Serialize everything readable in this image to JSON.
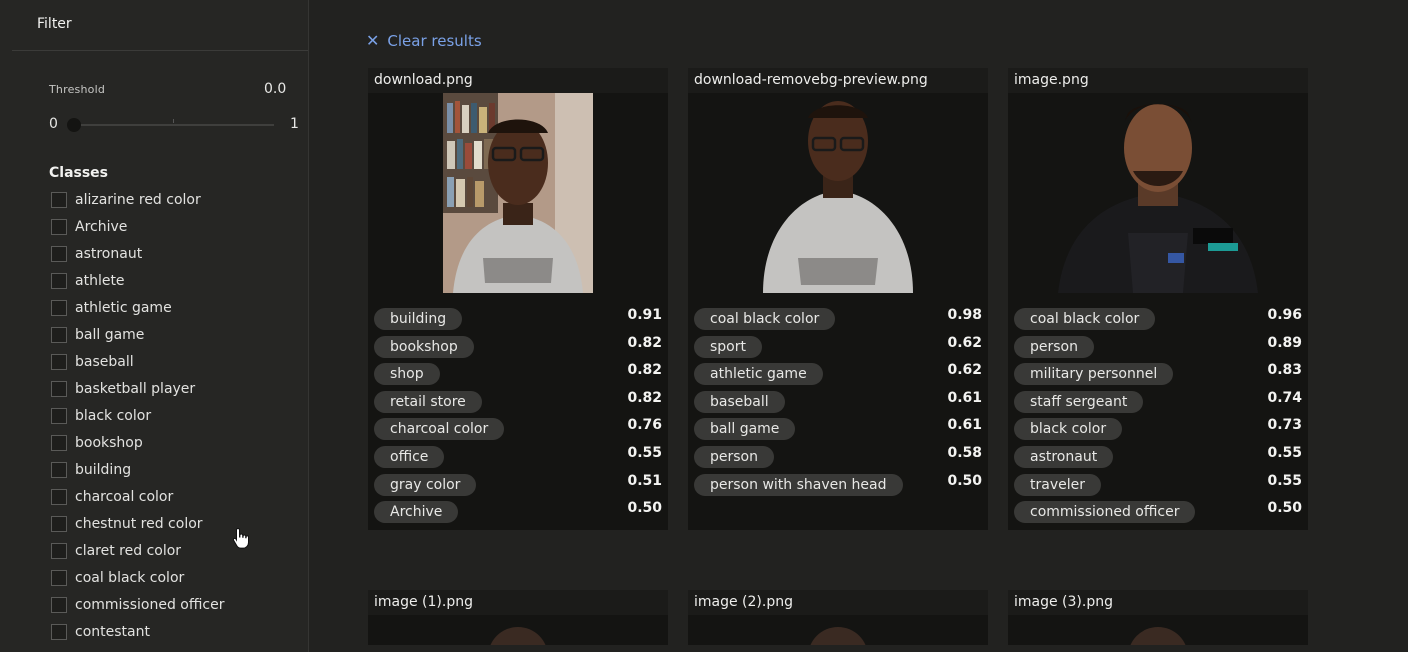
{
  "sidebar": {
    "filter_title": "Filter",
    "threshold_label": "Threshold",
    "threshold_value": "0.0",
    "slider_min": "0",
    "slider_max": "1",
    "classes_title": "Classes",
    "classes": [
      "alizarine red color",
      "Archive",
      "astronaut",
      "athlete",
      "athletic game",
      "ball game",
      "baseball",
      "basketball player",
      "black color",
      "bookshop",
      "building",
      "charcoal color",
      "chestnut red color",
      "claret red color",
      "coal black color",
      "commissioned officer",
      "contestant"
    ]
  },
  "main": {
    "clear_results": "Clear results",
    "cards": [
      {
        "filename": "download.png",
        "labels": [
          {
            "tag": "building",
            "score": "0.91"
          },
          {
            "tag": "bookshop",
            "score": "0.82"
          },
          {
            "tag": "shop",
            "score": "0.82"
          },
          {
            "tag": "retail store",
            "score": "0.82"
          },
          {
            "tag": "charcoal color",
            "score": "0.76"
          },
          {
            "tag": "office",
            "score": "0.55"
          },
          {
            "tag": "gray color",
            "score": "0.51"
          },
          {
            "tag": "Archive",
            "score": "0.50"
          }
        ]
      },
      {
        "filename": "download-removebg-preview.png",
        "labels": [
          {
            "tag": "coal black color",
            "score": "0.98"
          },
          {
            "tag": "sport",
            "score": "0.62"
          },
          {
            "tag": "athletic game",
            "score": "0.62"
          },
          {
            "tag": "baseball",
            "score": "0.61"
          },
          {
            "tag": "ball game",
            "score": "0.61"
          },
          {
            "tag": "person",
            "score": "0.58"
          },
          {
            "tag": "person with shaven head",
            "score": "0.50"
          }
        ]
      },
      {
        "filename": "image.png",
        "labels": [
          {
            "tag": "coal black color",
            "score": "0.96"
          },
          {
            "tag": "person",
            "score": "0.89"
          },
          {
            "tag": "military personnel",
            "score": "0.83"
          },
          {
            "tag": "staff sergeant",
            "score": "0.74"
          },
          {
            "tag": "black color",
            "score": "0.73"
          },
          {
            "tag": "astronaut",
            "score": "0.55"
          },
          {
            "tag": "traveler",
            "score": "0.55"
          },
          {
            "tag": "commissioned officer",
            "score": "0.50"
          }
        ]
      },
      {
        "filename": "image (1).png"
      },
      {
        "filename": "image (2).png"
      },
      {
        "filename": "image (3).png"
      }
    ]
  },
  "colors": {
    "background": "#222220",
    "sidebar": "#262624",
    "card_body": "#141412",
    "tag_bg": "#393937",
    "accent_link": "#7aa1e6"
  }
}
